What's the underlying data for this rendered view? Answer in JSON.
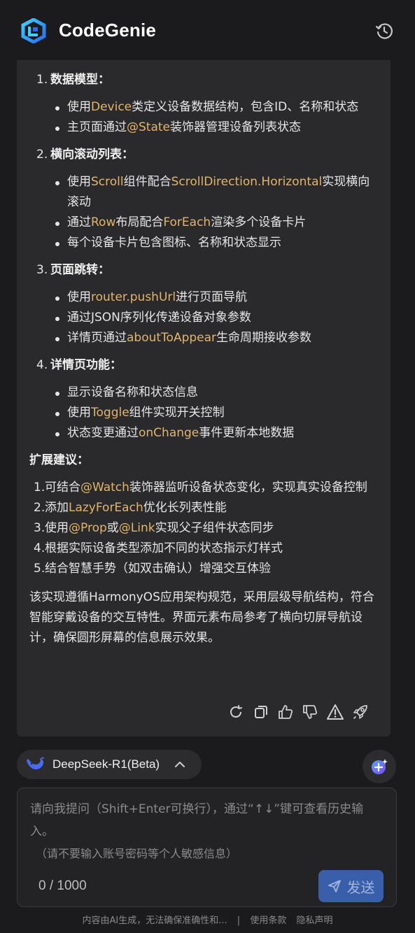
{
  "header": {
    "brand": "CodeGenie"
  },
  "sections": [
    {
      "num": "1.",
      "title": "数据模型：",
      "items": [
        [
          {
            "t": "使用"
          },
          {
            "c": "Device"
          },
          {
            "t": "类定义设备数据结构，包含ID、名称和状态"
          }
        ],
        [
          {
            "t": "主页面通过"
          },
          {
            "c": "@State"
          },
          {
            "t": "装饰器管理设备列表状态"
          }
        ]
      ]
    },
    {
      "num": "2.",
      "title": "横向滚动列表：",
      "items": [
        [
          {
            "t": "使用"
          },
          {
            "c": "Scroll"
          },
          {
            "t": "组件配合"
          },
          {
            "c": "ScrollDirection.Horizontal"
          },
          {
            "t": "实现横向滚动"
          }
        ],
        [
          {
            "t": "通过"
          },
          {
            "c": "Row"
          },
          {
            "t": "布局配合"
          },
          {
            "c": "ForEach"
          },
          {
            "t": "渲染多个设备卡片"
          }
        ],
        [
          {
            "t": "每个设备卡片包含图标、名称和状态显示"
          }
        ]
      ]
    },
    {
      "num": "3.",
      "title": "页面跳转：",
      "items": [
        [
          {
            "t": "使用"
          },
          {
            "c": "router.pushUrl"
          },
          {
            "t": "进行页面导航"
          }
        ],
        [
          {
            "t": "通过JSON序列化传递设备对象参数"
          }
        ],
        [
          {
            "t": "详情页通过"
          },
          {
            "c": "aboutToAppear"
          },
          {
            "t": "生命周期接收参数"
          }
        ]
      ]
    },
    {
      "num": "4.",
      "title": "详情页功能：",
      "items": [
        [
          {
            "t": "显示设备名称和状态信息"
          }
        ],
        [
          {
            "t": "使用"
          },
          {
            "c": "Toggle"
          },
          {
            "t": "组件实现开关控制"
          }
        ],
        [
          {
            "t": "状态变更通过"
          },
          {
            "c": "onChange"
          },
          {
            "t": "事件更新本地数据"
          }
        ]
      ]
    }
  ],
  "extension": {
    "title": "扩展建议：",
    "items": [
      {
        "num": "1.",
        "parts": [
          {
            "t": "可结合"
          },
          {
            "c": "@Watch"
          },
          {
            "t": "装饰器监听设备状态变化，实现真实设备控制"
          }
        ]
      },
      {
        "num": "2.",
        "parts": [
          {
            "t": "添加"
          },
          {
            "c": "LazyForEach"
          },
          {
            "t": "优化长列表性能"
          }
        ]
      },
      {
        "num": "3.",
        "parts": [
          {
            "t": "使用"
          },
          {
            "c": "@Prop"
          },
          {
            "t": "或"
          },
          {
            "c": "@Link"
          },
          {
            "t": "实现父子组件状态同步"
          }
        ]
      },
      {
        "num": "4.",
        "parts": [
          {
            "t": "根据实际设备类型添加不同的状态指示灯样式"
          }
        ]
      },
      {
        "num": "5.",
        "parts": [
          {
            "t": "结合智慧手势（如双击确认）增强交互体验"
          }
        ]
      }
    ]
  },
  "summary": "该实现遵循HarmonyOS应用架构规范，采用层级导航结构，符合智能穿戴设备的交互特性。界面元素布局参考了横向切屏导航设计，确保圆形屏幕的信息展示效果。",
  "model": {
    "label": "DeepSeek-R1(Beta)"
  },
  "input": {
    "placeholder": "请向我提问（Shift+Enter可换行），通过“↑↓”键可查看历史输入。",
    "hint": "（请不要输入账号密码等个人敏感信息）",
    "counter": "0 / 1000",
    "send_label": "发送"
  },
  "footer": {
    "disclaimer": "内容由AI生成，无法确保准确性和...",
    "separator": "|",
    "terms": "使用条款",
    "privacy": "隐私声明"
  },
  "colors": {
    "code": "#e3b46b",
    "accent": "#3a5faa",
    "card": "#2a2a2c"
  }
}
